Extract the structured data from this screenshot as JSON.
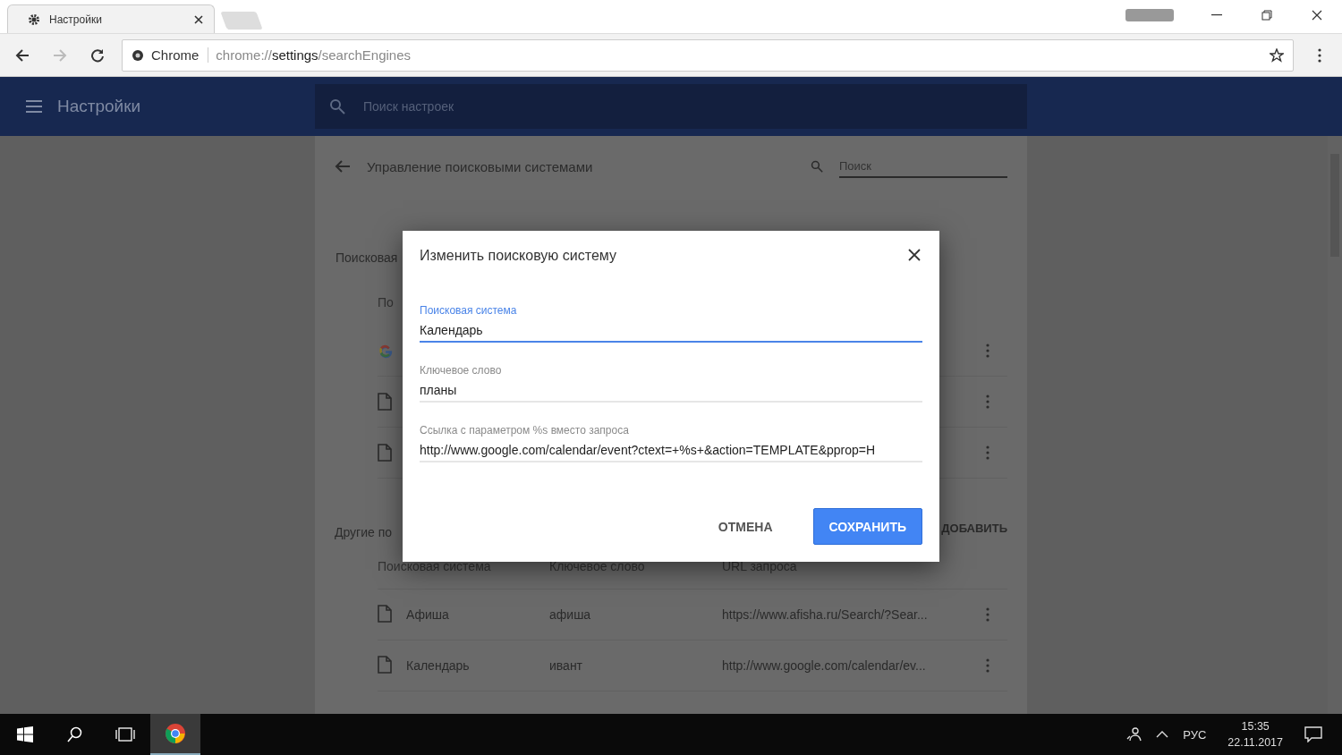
{
  "browser": {
    "tabs": [
      {
        "title": "Настройки",
        "selected": true
      }
    ],
    "omnibox": {
      "site_label": "Chrome",
      "url_scheme": "chrome://",
      "url_host": "settings",
      "url_path": "/searchEngines"
    }
  },
  "settings_header": {
    "title": "Настройки",
    "search_placeholder": "Поиск настроек"
  },
  "page": {
    "title": "Управление поисковыми системами",
    "search_placeholder": "Поиск",
    "default_section": {
      "title": "Поисковая",
      "column_header": "По",
      "rows": [
        {
          "kind": "google"
        },
        {
          "kind": "page"
        },
        {
          "kind": "page"
        }
      ]
    },
    "other_section": {
      "title": "Другие по",
      "add_button": "ДОБАВИТЬ",
      "columns": [
        "Поисковая система",
        "Ключевое слово",
        "URL запроса"
      ],
      "rows": [
        {
          "name": "Афиша",
          "keyword": "афиша",
          "url": "https://www.afisha.ru/Search/?Sear..."
        },
        {
          "name": "Календарь",
          "keyword": "ивант",
          "url": "http://www.google.com/calendar/ev..."
        }
      ]
    }
  },
  "dialog": {
    "title": "Изменить поисковую систему",
    "fields": [
      {
        "label": "Поисковая система",
        "value": "Календарь",
        "focused": true
      },
      {
        "label": "Ключевое слово",
        "value": "планы",
        "focused": false
      },
      {
        "label": "Ссылка с параметром %s вместо запроса",
        "value": "http://www.google.com/calendar/event?ctext=+%s+&action=TEMPLATE&pprop=H",
        "focused": false
      }
    ],
    "buttons": [
      {
        "label": "ОТМЕНА",
        "kind": "text"
      },
      {
        "label": "СОХРАНИТЬ",
        "kind": "primary"
      }
    ]
  },
  "taskbar": {
    "language": "РУС",
    "time": "15:35",
    "date": "22.11.2017"
  }
}
